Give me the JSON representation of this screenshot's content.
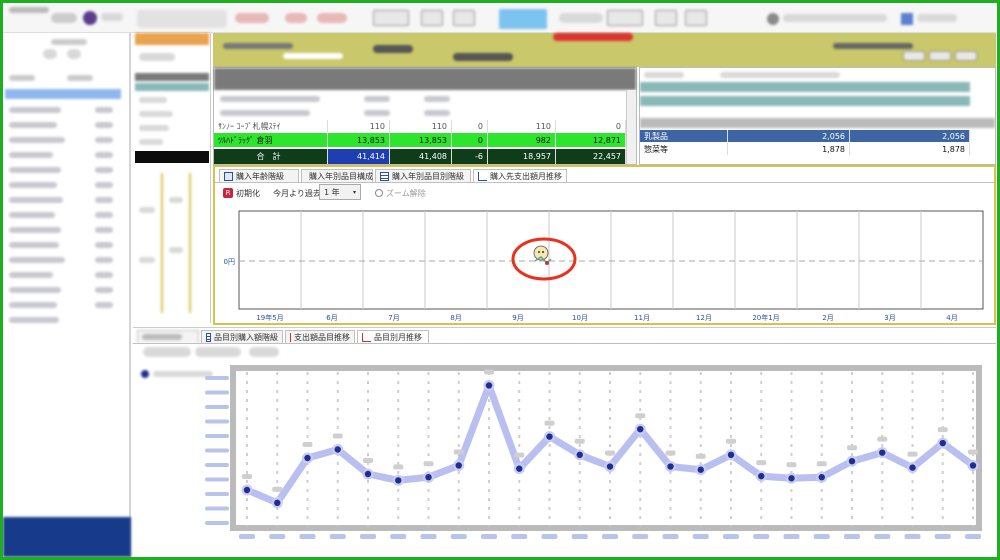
{
  "colors": {
    "frame": "#1fae1f",
    "toolbar_yellow": "#c9c86a",
    "grid_header": "#7a7a7a",
    "highlight_green": "#2ee52e",
    "total_dark": "#0f3d1a",
    "total_blue": "#1f3fb0",
    "selected_blue": "#3d64a3",
    "series_line": "#b9bff0",
    "series_point": "#1e2f8f",
    "annotation": "#e8321e"
  },
  "icons": [
    "calendar-icon",
    "pie-chart-icon",
    "table-icon",
    "line-chart-icon",
    "reset-icon",
    "zoom-reset-icon",
    "dropdown-icon",
    "mascot-icon"
  ],
  "grid": {
    "rows": [
      {
        "name": "ｻﾝﾉｰ ｺｰﾌﾟ札幌ｽﾃｲ",
        "v1": "110",
        "v2": "110",
        "v3": "0",
        "v4": "110",
        "v5": "0"
      },
      {
        "name": "ﾂﾙﾊﾄﾞﾗｯｸﾞ 倉羽",
        "v1": "13,853",
        "v2": "13,853",
        "v3": "0",
        "v4": "982",
        "v5": "12,871"
      }
    ],
    "total": {
      "label": "合　計",
      "v1": "41,414",
      "v2": "41,408",
      "v3": "-6",
      "v4": "18,957",
      "v5": "22,457"
    }
  },
  "right_list": [
    {
      "name": "乳製品",
      "v1": "2,056",
      "v2": "2,056"
    },
    {
      "name": "惣菜等",
      "v1": "1,878",
      "v2": "1,878"
    }
  ],
  "upper_tabs": [
    "購入年齢階級",
    "購入年別品目構成",
    "購入年別品目別階級",
    "購入先支出額月推移"
  ],
  "upper_toolbar": {
    "reset_label": "初期化",
    "range_label": "今月より過去",
    "range_value": "1 年",
    "zoom_reset_label": "ズーム解除"
  },
  "upper_chart": {
    "y_label": "0円",
    "x_labels": [
      "19年5月",
      "6月",
      "7月",
      "8月",
      "9月",
      "10月",
      "11月",
      "12月",
      "20年1月",
      "2月",
      "3月",
      "4月"
    ]
  },
  "lower_tabs": [
    "品目別購入額階級",
    "支出額品目推移",
    "品目別月推移"
  ],
  "chart_data": {
    "type": "line",
    "title": "",
    "xlabel": "",
    "ylabel": "",
    "series": [
      {
        "values": [
          30,
          18,
          60,
          68,
          45,
          39,
          42,
          53,
          128,
          50,
          80,
          63,
          52,
          87,
          52,
          49,
          63,
          43,
          41,
          42,
          57,
          65,
          51,
          74,
          53
        ]
      }
    ]
  }
}
